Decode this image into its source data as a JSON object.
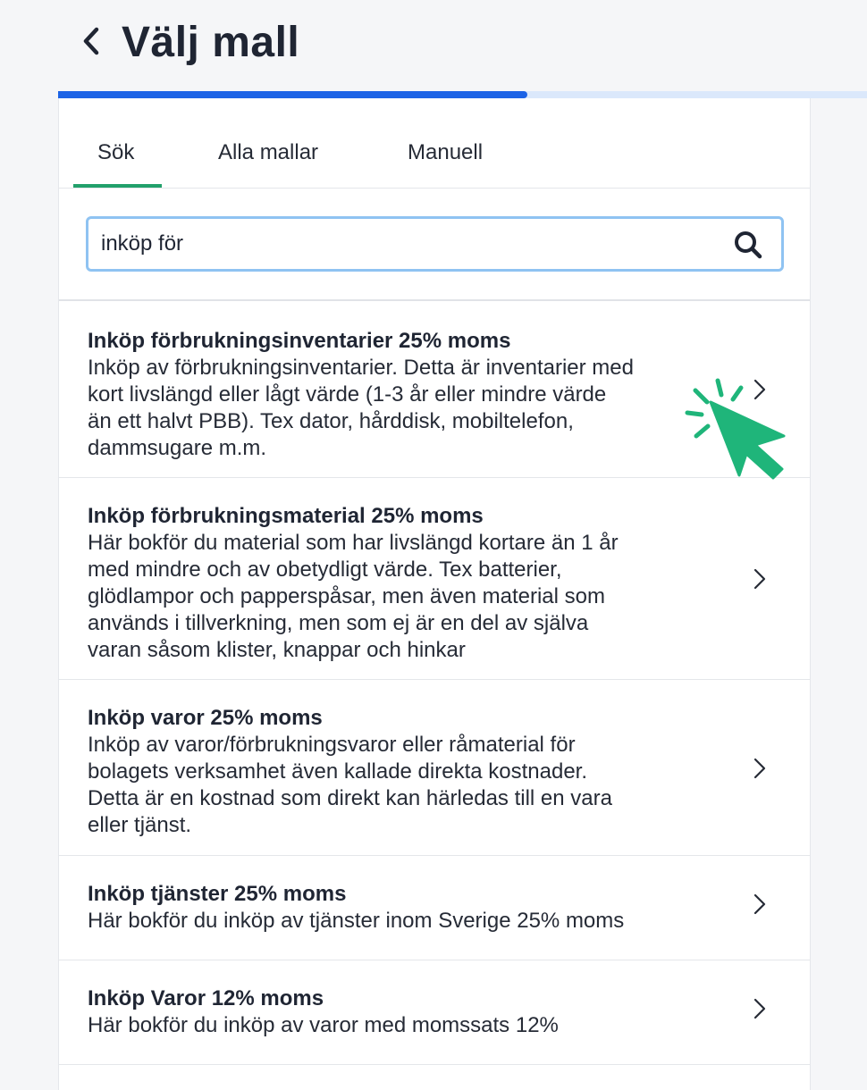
{
  "header": {
    "title": "Välj mall",
    "back_icon": "chevron-left-icon"
  },
  "progress": {
    "value_percent": 58,
    "fill_color": "#1c63e6",
    "track_color": "#dbe8fb"
  },
  "tabs": [
    {
      "label": "Sök",
      "active": true
    },
    {
      "label": "Alla mallar",
      "active": false
    },
    {
      "label": "Manuell",
      "active": false
    }
  ],
  "search": {
    "value": "inköp för",
    "icon": "search-icon"
  },
  "results": [
    {
      "title": "Inköp förbrukningsinventarier 25% moms",
      "lines": [
        "Inköp av förbrukningsinventarier. Detta är inventarier med",
        "kort livslängd eller lågt värde (1-3 år eller mindre värde",
        "än ett halvt PBB). Tex dator, hårddisk, mobiltelefon,",
        "dammsugare m.m."
      ]
    },
    {
      "title": "Inköp förbrukningsmaterial 25% moms",
      "lines": [
        "Här bokför du material som har livslängd kortare än 1 år",
        "med mindre och av obetydligt värde. Tex batterier,",
        "glödlampor och papperspåsar, men även material som",
        "används i tillverkning, men som ej är en del av själva",
        "varan såsom klister, knappar och hinkar"
      ]
    },
    {
      "title": "Inköp varor 25% moms",
      "lines": [
        "Inköp av varor/förbrukningsvaror eller råmaterial för",
        "bolagets verksamhet även kallade direkta kostnader.",
        "Detta är en kostnad som direkt kan härledas till en vara",
        "eller tjänst."
      ]
    },
    {
      "title": "Inköp tjänster 25% moms",
      "lines": [
        "Här bokför du inköp av tjänster inom Sverige 25% moms"
      ]
    },
    {
      "title": "Inköp Varor 12% moms",
      "lines": [
        "Här bokför du inköp av varor med momssats 12%"
      ]
    }
  ],
  "colors": {
    "accent_green": "#22a06b",
    "cursor_green": "#1fb57a",
    "focus_border": "#8fc3f2"
  }
}
